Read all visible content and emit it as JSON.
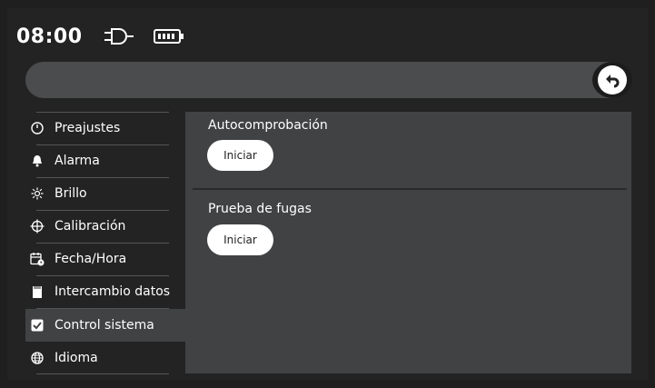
{
  "status": {
    "time": "08:00",
    "icons": [
      "plug-icon",
      "battery-icon"
    ]
  },
  "topbar": {
    "back_icon": "back-arrow-icon"
  },
  "sidebar": {
    "items": [
      {
        "label": "Preajustes",
        "icon": "timer-icon"
      },
      {
        "label": "Alarma",
        "icon": "bell-icon"
      },
      {
        "label": "Brillo",
        "icon": "sun-icon"
      },
      {
        "label": "Calibración",
        "icon": "crosshair-icon"
      },
      {
        "label": "Fecha/Hora",
        "icon": "calendar-clock-icon"
      },
      {
        "label": "Intercambio datos",
        "icon": "sd-card-icon"
      },
      {
        "label": "Control sistema",
        "icon": "checkbox-icon",
        "active": true
      },
      {
        "label": "Idioma",
        "icon": "globe-icon"
      }
    ]
  },
  "main": {
    "sections": [
      {
        "title": "Autocomprobación",
        "button": "Iniciar"
      },
      {
        "title": "Prueba de fugas",
        "button": "Iniciar"
      }
    ]
  },
  "colors": {
    "background": "#1f1f1f",
    "panel": "#404243",
    "topbar": "#4a4c4d",
    "button": "#ffffff"
  }
}
